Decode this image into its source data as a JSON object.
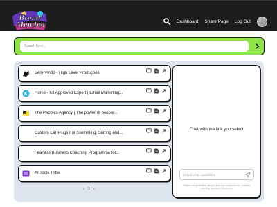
{
  "brand": {
    "logo_text": "Brand Member"
  },
  "nav": {
    "dashboard": "Dashboard",
    "share_page": "Share Page",
    "logout": "Log Out",
    "icons": {
      "search": "search-icon",
      "avatar": "user-avatar"
    }
  },
  "search": {
    "placeholder": "Search here..."
  },
  "links": [
    {
      "title": "Bem-Vindo - High Level Produções",
      "icon": "wolf-logo-icon"
    },
    {
      "title": "Home - Kit Approved Expert | Email Marketing...",
      "icon": "k-circle-logo-icon"
    },
    {
      "title": "The Peoples Agency | The power of people...",
      "icon": "flag-logo-icon"
    },
    {
      "title": "Custom Ear Plugs For Swimming, Surfing and...",
      "icon": ""
    },
    {
      "title": "Fearless Business Coaching Programme for...",
      "icon": ""
    },
    {
      "title": "AI Tools Tribe",
      "icon": "purple-square-logo-icon"
    }
  ],
  "pagination": {
    "prev": "‹",
    "page": "1",
    "next": "›"
  },
  "chat": {
    "heading": "Chat with the link you select",
    "input_placeholder": "Unlock chat capabilities",
    "disclaimer": "Replies are generated using AI and may contain errors. Consider checking important information."
  },
  "colors": {
    "topbar": "#1d1d1d",
    "search_accent": "#8fe44a",
    "panel_bg": "#dde4ee",
    "card_border": "#111111"
  }
}
